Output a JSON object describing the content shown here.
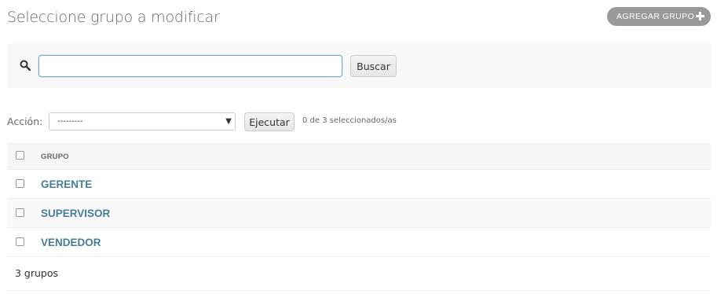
{
  "header": {
    "title": "Seleccione grupo a modificar",
    "add_button_label": "AGREGAR GRUPO"
  },
  "search": {
    "value": "",
    "placeholder": "",
    "button_label": "Buscar"
  },
  "actions": {
    "label": "Acción:",
    "selected_option": "---------",
    "run_label": "Ejecutar",
    "counter": "0 de 3 seleccionados/as"
  },
  "table": {
    "column_header": "GRUPO",
    "rows": [
      {
        "name": "GERENTE"
      },
      {
        "name": "SUPERVISOR"
      },
      {
        "name": "VENDEDOR"
      }
    ]
  },
  "paginator": {
    "text": "3 grupos"
  },
  "colors": {
    "link": "#447e9b",
    "add_button_bg": "#999999",
    "focus_border": "#79aec8"
  },
  "icons": {
    "add": "plus-icon",
    "search": "search-icon"
  }
}
